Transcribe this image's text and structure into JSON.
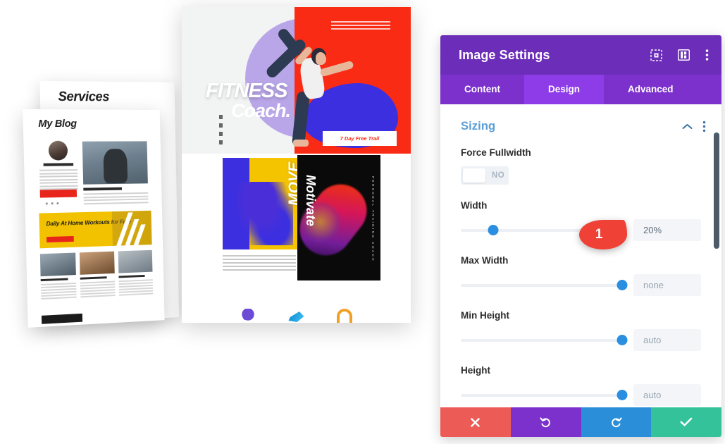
{
  "panel": {
    "title": "Image Settings",
    "header_icons": [
      {
        "name": "fullscreen-icon",
        "label": "fullscreen"
      },
      {
        "name": "layout-view-icon",
        "label": "view-mode"
      },
      {
        "name": "more-options-icon",
        "label": "more"
      }
    ],
    "tabs": [
      {
        "label": "Content",
        "active": false
      },
      {
        "label": "Design",
        "active": true
      },
      {
        "label": "Advanced",
        "active": false
      }
    ],
    "section": {
      "title": "Sizing",
      "collapse_icon": "chevron-up-icon",
      "menu_icon": "more-options-icon"
    },
    "fields": [
      {
        "label": "Force Fullwidth",
        "type": "toggle",
        "state": "NO"
      },
      {
        "label": "Width",
        "type": "slider",
        "value": "20%",
        "is_placeholder": false,
        "knob_percent": 20
      },
      {
        "label": "Max Width",
        "type": "slider",
        "value": "none",
        "is_placeholder": true,
        "knob_percent": 100
      },
      {
        "label": "Min Height",
        "type": "slider",
        "value": "auto",
        "is_placeholder": true,
        "knob_percent": 100
      },
      {
        "label": "Height",
        "type": "slider",
        "value": "auto",
        "is_placeholder": true,
        "knob_percent": 100
      }
    ],
    "footer_buttons": [
      {
        "name": "close-button",
        "icon": "close-icon",
        "color": "#ec5b56"
      },
      {
        "name": "undo-button",
        "icon": "undo-icon",
        "color": "#7c30cc"
      },
      {
        "name": "redo-button",
        "icon": "redo-icon",
        "color": "#2a8fd8"
      },
      {
        "name": "save-button",
        "icon": "check-icon",
        "color": "#34c29a"
      }
    ],
    "colors": {
      "header": "#6c2eb9",
      "tabs_bar": "#7c30cc",
      "tab_active": "#8e3ce8",
      "section_title": "#5b9fd6",
      "slider_knob": "#2a8fe0"
    }
  },
  "marker": {
    "number": "1",
    "color": "#ef4136"
  },
  "canvas": {
    "sheets": {
      "services": {
        "title": "Services"
      },
      "blog": {
        "title": "My Blog",
        "banner": "Daily At Home Workouts for Free"
      },
      "fitness": {
        "word1": "FITNESS",
        "word2": "Coach.",
        "cta": "7 Day Free Trail",
        "move_label": "MOVE",
        "motivate_label": "Motivate",
        "vertical_caption": "PERSONAL TRAINING COACH"
      }
    },
    "icon_row": [
      {
        "name": "runner-icon"
      },
      {
        "name": "swimmer-icon"
      },
      {
        "name": "gym-arch-icon"
      }
    ]
  }
}
